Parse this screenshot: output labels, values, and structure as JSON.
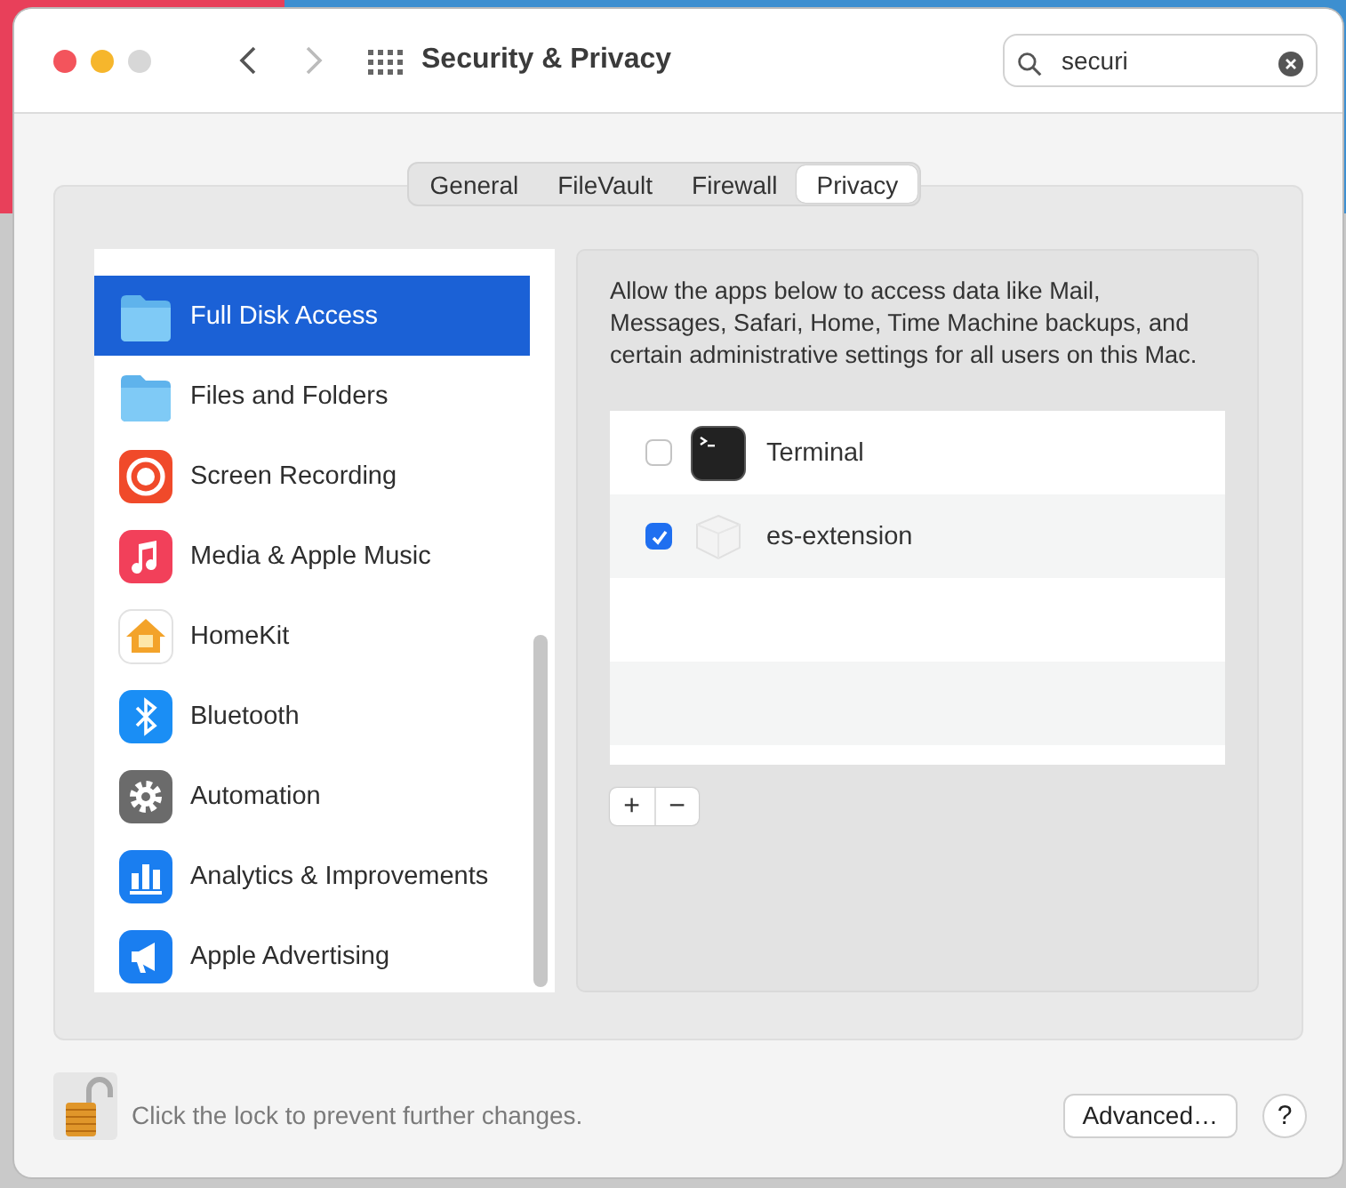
{
  "window": {
    "title": "Security & Privacy",
    "search": {
      "value": "securi"
    }
  },
  "tabs": [
    {
      "label": "General",
      "selected": false
    },
    {
      "label": "FileVault",
      "selected": false
    },
    {
      "label": "Firewall",
      "selected": false
    },
    {
      "label": "Privacy",
      "selected": true
    }
  ],
  "sidebar": {
    "items": [
      {
        "label": "Full Disk Access",
        "selected": true
      },
      {
        "label": "Files and Folders",
        "selected": false
      },
      {
        "label": "Screen Recording",
        "selected": false
      },
      {
        "label": "Media & Apple Music",
        "selected": false
      },
      {
        "label": "HomeKit",
        "selected": false
      },
      {
        "label": "Bluetooth",
        "selected": false
      },
      {
        "label": "Automation",
        "selected": false
      },
      {
        "label": "Analytics & Improvements",
        "selected": false
      },
      {
        "label": "Apple Advertising",
        "selected": false
      }
    ]
  },
  "description": "Allow the apps below to access data like Mail, Messages, Safari, Home, Time Machine backups, and certain administrative settings for all users on this Mac.",
  "apps": [
    {
      "name": "Terminal",
      "checked": false
    },
    {
      "name": "es-extension",
      "checked": true
    }
  ],
  "list_buttons": [
    "+",
    "−"
  ],
  "lock_message": "Click the lock to prevent further changes.",
  "buttons": [
    {
      "label": "Advanced…",
      "kind": "text"
    },
    {
      "label": "?",
      "kind": "help"
    }
  ]
}
